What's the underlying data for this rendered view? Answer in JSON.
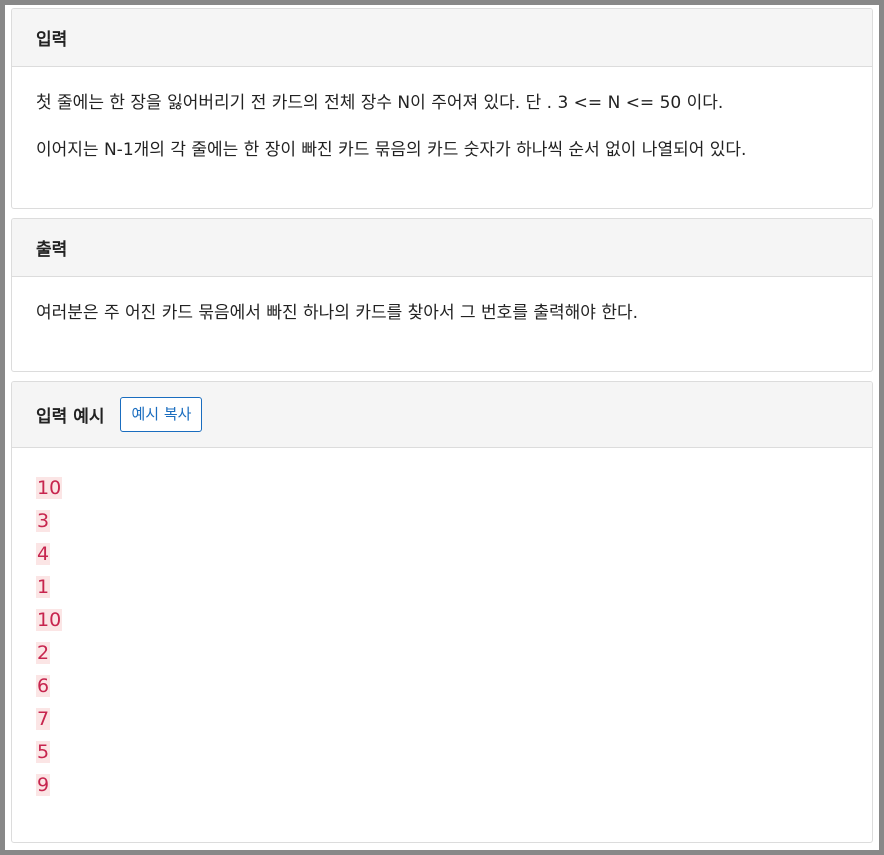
{
  "input_section": {
    "title": "입력",
    "lines": [
      "첫 줄에는 한 장을 잃어버리기 전 카드의 전체 장수 N이 주어져 있다. 단 . 3 <= N <= 50 이다.",
      "이어지는 N-1개의 각 줄에는 한 장이 빠진 카드 묶음의 카드 숫자가 하나씩 순서 없이 나열되어 있다."
    ]
  },
  "output_section": {
    "title": "출력",
    "lines": [
      "여러분은 주 어진 카드 묶음에서 빠진 하나의 카드를 찾아서 그 번호를 출력해야 한다."
    ]
  },
  "sample_input_section": {
    "title": "입력 예시",
    "copy_button_label": "예시 복사",
    "lines": [
      "10",
      "3",
      "4",
      "1",
      "10",
      "2",
      "6",
      "7",
      "5",
      "9"
    ]
  }
}
